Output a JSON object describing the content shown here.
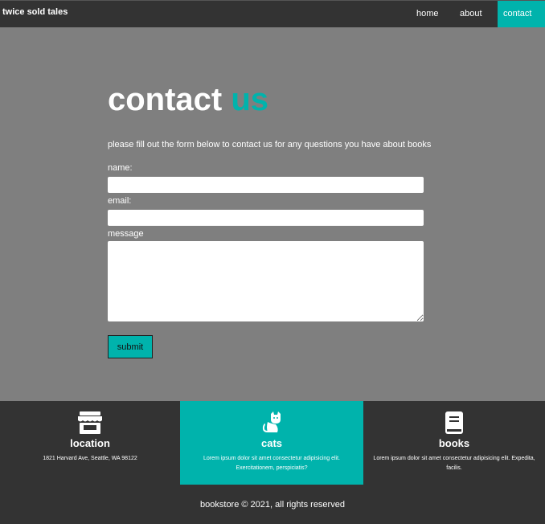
{
  "nav": {
    "brand": "twice sold tales",
    "links": [
      {
        "label": "home",
        "active": false
      },
      {
        "label": "about",
        "active": false
      },
      {
        "label": "contact",
        "active": true
      }
    ]
  },
  "hero": {
    "title_main": "contact",
    "title_accent": "us",
    "intro": "please fill out the form below to contact us for any questions you have about books"
  },
  "form": {
    "name_label": "name:",
    "name_value": "",
    "email_label": "email:",
    "email_value": "",
    "message_label": "message",
    "message_value": "",
    "submit_label": "submit"
  },
  "footer": {
    "columns": [
      {
        "icon": "store-icon",
        "title": "location",
        "text": "1821 Harvard Ave, Seattle, WA 98122"
      },
      {
        "icon": "cat-icon",
        "title": "cats",
        "text": "Lorem ipsum dolor sit amet consectetur adipisicing elit. Exercitationem, perspiciatis?"
      },
      {
        "icon": "book-icon",
        "title": "books",
        "text": "Lorem ipsum dolor sit amet consectetur adipisicing elit. Expedita, facilis."
      }
    ],
    "copyright": "bookstore © 2021, all rights reserved"
  },
  "colors": {
    "accent": "#00b3ac",
    "nav_bg": "#333333",
    "page_bg": "#7f7f7f"
  }
}
